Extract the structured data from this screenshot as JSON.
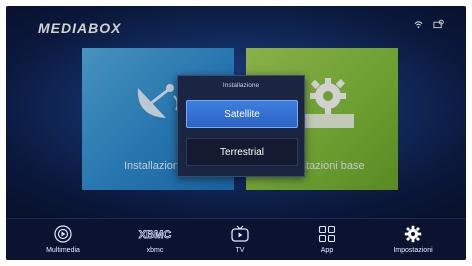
{
  "header": {
    "brand": "MEDIABOX"
  },
  "tiles": [
    {
      "label": "Installazione",
      "color": "#3a9be0"
    },
    {
      "label": "Impostazioni base",
      "color": "#8cc63f"
    }
  ],
  "dialog": {
    "title": "Installazione",
    "options": [
      {
        "label": "Satellite",
        "selected": true
      },
      {
        "label": "Terrestrial",
        "selected": false
      }
    ]
  },
  "bottom_nav": [
    {
      "label": "Multimedia",
      "icon": "multimedia-icon"
    },
    {
      "label": "xbmc",
      "icon": "xbmc-logo"
    },
    {
      "label": "TV",
      "icon": "tv-icon"
    },
    {
      "label": "App",
      "icon": "apps-grid-icon"
    },
    {
      "label": "Impostazioni",
      "icon": "gear-icon"
    }
  ],
  "status_icons": [
    "wifi-icon",
    "settings-device-icon"
  ],
  "colors": {
    "accent": "#2f6fd6",
    "background": "#183a7c",
    "bar": "#0b1330"
  }
}
